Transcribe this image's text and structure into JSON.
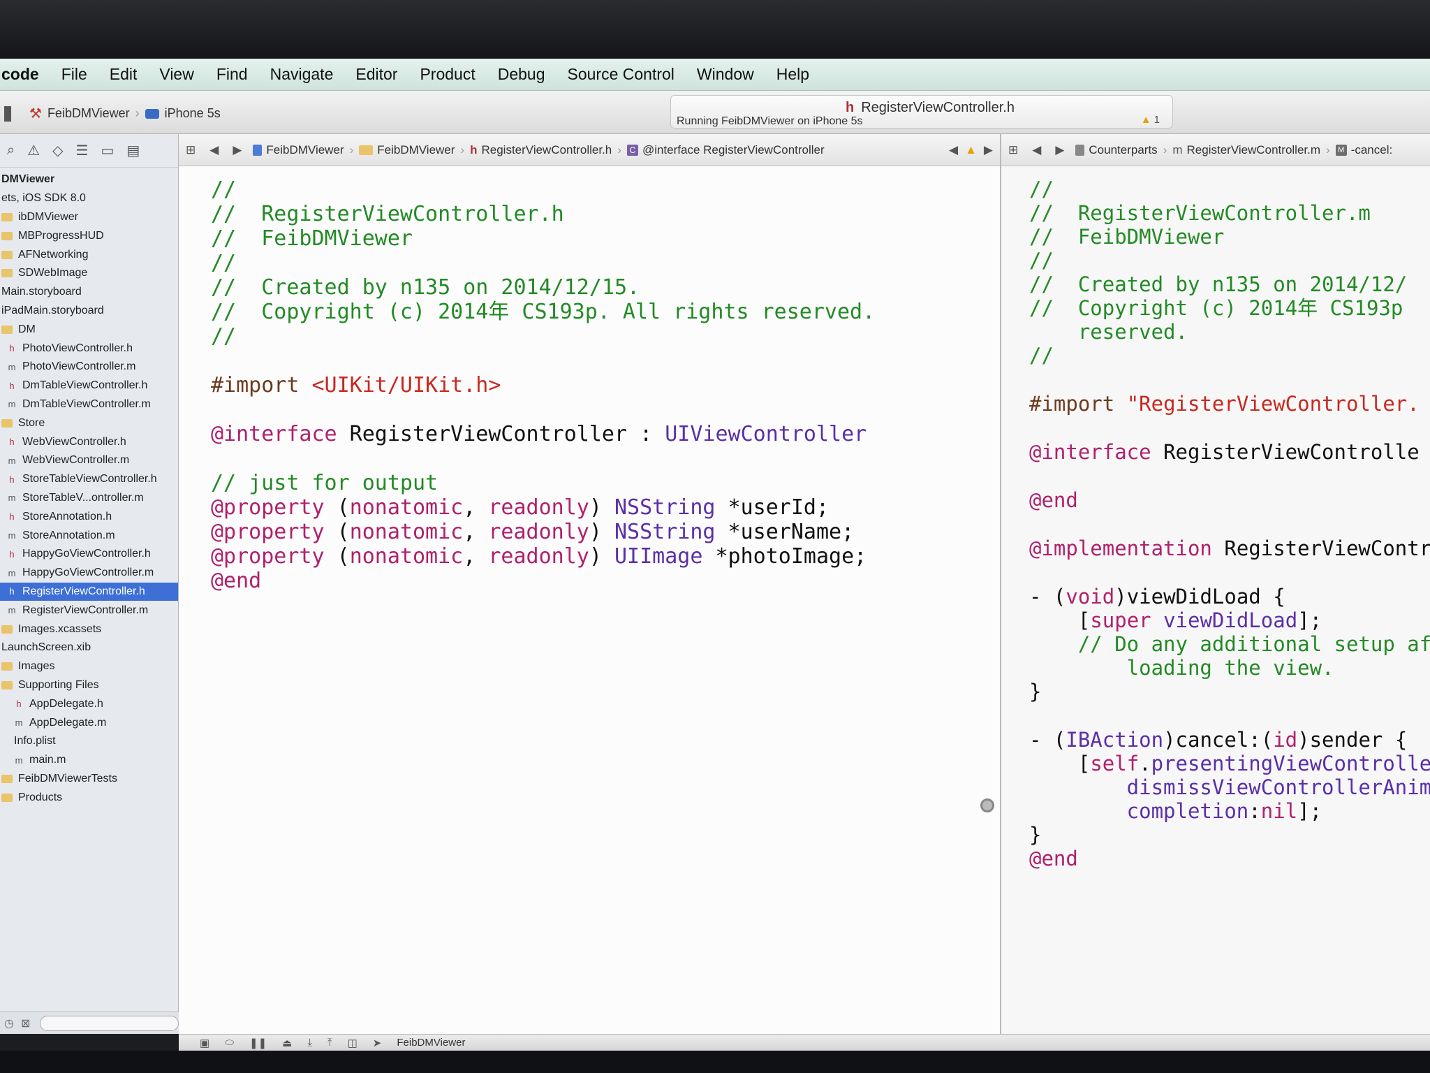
{
  "menubar": {
    "app": "code",
    "items": [
      "File",
      "Edit",
      "View",
      "Find",
      "Navigate",
      "Editor",
      "Product",
      "Debug",
      "Source Control",
      "Window",
      "Help"
    ]
  },
  "toolbar": {
    "scheme_project": "FeibDMViewer",
    "scheme_device": "iPhone 5s",
    "activity_file": "RegisterViewController.h",
    "activity_status": "Running FeibDMViewer on iPhone 5s",
    "warning_count": "1"
  },
  "navigator": {
    "items": [
      {
        "label": "DMViewer",
        "kind": "project"
      },
      {
        "label": "ets, iOS SDK 8.0",
        "kind": "sub"
      },
      {
        "label": "ibDMViewer",
        "kind": "folder"
      },
      {
        "label": "MBProgressHUD",
        "kind": "folder"
      },
      {
        "label": "AFNetworking",
        "kind": "folder"
      },
      {
        "label": "SDWebImage",
        "kind": "folder"
      },
      {
        "label": "Main.storyboard",
        "kind": "file"
      },
      {
        "label": "iPadMain.storyboard",
        "kind": "file"
      },
      {
        "label": "DM",
        "kind": "folder"
      },
      {
        "label": "PhotoViewController.h",
        "kind": "h"
      },
      {
        "label": "PhotoViewController.m",
        "kind": "m"
      },
      {
        "label": "DmTableViewController.h",
        "kind": "h"
      },
      {
        "label": "DmTableViewController.m",
        "kind": "m"
      },
      {
        "label": "Store",
        "kind": "folder"
      },
      {
        "label": "WebViewController.h",
        "kind": "h"
      },
      {
        "label": "WebViewController.m",
        "kind": "m"
      },
      {
        "label": "StoreTableViewController.h",
        "kind": "h"
      },
      {
        "label": "StoreTableV...ontroller.m",
        "kind": "m"
      },
      {
        "label": "StoreAnnotation.h",
        "kind": "h"
      },
      {
        "label": "StoreAnnotation.m",
        "kind": "m"
      },
      {
        "label": "HappyGoViewController.h",
        "kind": "h"
      },
      {
        "label": "HappyGoViewController.m",
        "kind": "m"
      },
      {
        "label": "RegisterViewController.h",
        "kind": "h",
        "selected": true
      },
      {
        "label": "RegisterViewController.m",
        "kind": "m"
      },
      {
        "label": "Images.xcassets",
        "kind": "folder"
      },
      {
        "label": "LaunchScreen.xib",
        "kind": "file"
      },
      {
        "label": "Images",
        "kind": "folder"
      },
      {
        "label": "Supporting Files",
        "kind": "folder"
      },
      {
        "label": "AppDelegate.h",
        "kind": "h"
      },
      {
        "label": "AppDelegate.m",
        "kind": "m"
      },
      {
        "label": "Info.plist",
        "kind": "file"
      },
      {
        "label": "main.m",
        "kind": "m"
      },
      {
        "label": "FeibDMViewerTests",
        "kind": "folder"
      },
      {
        "label": "Products",
        "kind": "folder"
      }
    ]
  },
  "editor_left": {
    "jumpbar": [
      "FeibDMViewer",
      "FeibDMViewer",
      "RegisterViewController.h",
      "@interface RegisterViewController"
    ],
    "lines": [
      [
        [
          "c-comment",
          "//"
        ]
      ],
      [
        [
          "c-comment",
          "//  RegisterViewController.h"
        ]
      ],
      [
        [
          "c-comment",
          "//  FeibDMViewer"
        ]
      ],
      [
        [
          "c-comment",
          "//"
        ]
      ],
      [
        [
          "c-comment",
          "//  Created by n135 on 2014/12/15."
        ]
      ],
      [
        [
          "c-comment",
          "//  Copyright (c) 2014年 CS193p. All rights reserved."
        ]
      ],
      [
        [
          "c-comment",
          "//"
        ]
      ],
      [
        [
          "c-plain",
          ""
        ]
      ],
      [
        [
          "c-dir",
          "#import "
        ],
        [
          "c-str",
          "<UIKit/UIKit.h>"
        ]
      ],
      [
        [
          "c-plain",
          ""
        ]
      ],
      [
        [
          "c-kw",
          "@interface"
        ],
        [
          "c-plain",
          " RegisterViewController : "
        ],
        [
          "c-type",
          "UIViewController"
        ]
      ],
      [
        [
          "c-plain",
          ""
        ]
      ],
      [
        [
          "c-comment",
          "// just for output"
        ]
      ],
      [
        [
          "c-kw",
          "@property"
        ],
        [
          "c-plain",
          " ("
        ],
        [
          "c-kw",
          "nonatomic"
        ],
        [
          "c-plain",
          ", "
        ],
        [
          "c-kw",
          "readonly"
        ],
        [
          "c-plain",
          ") "
        ],
        [
          "c-type",
          "NSString"
        ],
        [
          "c-plain",
          " *userId;"
        ]
      ],
      [
        [
          "c-kw",
          "@property"
        ],
        [
          "c-plain",
          " ("
        ],
        [
          "c-kw",
          "nonatomic"
        ],
        [
          "c-plain",
          ", "
        ],
        [
          "c-kw",
          "readonly"
        ],
        [
          "c-plain",
          ") "
        ],
        [
          "c-type",
          "NSString"
        ],
        [
          "c-plain",
          " *userName;"
        ]
      ],
      [
        [
          "c-kw",
          "@property"
        ],
        [
          "c-plain",
          " ("
        ],
        [
          "c-kw",
          "nonatomic"
        ],
        [
          "c-plain",
          ", "
        ],
        [
          "c-kw",
          "readonly"
        ],
        [
          "c-plain",
          ") "
        ],
        [
          "c-type",
          "UIImage"
        ],
        [
          "c-plain",
          " *photoImage;"
        ]
      ],
      [
        [
          "c-kw",
          "@end"
        ]
      ]
    ]
  },
  "editor_right": {
    "jumpbar": [
      "Counterparts",
      "RegisterViewController.m",
      "-cancel:"
    ],
    "lines": [
      [
        [
          "c-comment",
          "//"
        ]
      ],
      [
        [
          "c-comment",
          "//  RegisterViewController.m"
        ]
      ],
      [
        [
          "c-comment",
          "//  FeibDMViewer"
        ]
      ],
      [
        [
          "c-comment",
          "//"
        ]
      ],
      [
        [
          "c-comment",
          "//  Created by n135 on 2014/12/"
        ]
      ],
      [
        [
          "c-comment",
          "//  Copyright (c) 2014年 CS193p"
        ]
      ],
      [
        [
          "c-comment",
          "    reserved."
        ]
      ],
      [
        [
          "c-comment",
          "//"
        ]
      ],
      [
        [
          "c-plain",
          ""
        ]
      ],
      [
        [
          "c-dir",
          "#import "
        ],
        [
          "c-str",
          "\"RegisterViewController."
        ]
      ],
      [
        [
          "c-plain",
          ""
        ]
      ],
      [
        [
          "c-kw",
          "@interface"
        ],
        [
          "c-plain",
          " RegisterViewControlle"
        ]
      ],
      [
        [
          "c-plain",
          ""
        ]
      ],
      [
        [
          "c-kw",
          "@end"
        ]
      ],
      [
        [
          "c-plain",
          ""
        ]
      ],
      [
        [
          "c-kw",
          "@implementation"
        ],
        [
          "c-plain",
          " RegisterViewContr"
        ]
      ],
      [
        [
          "c-plain",
          ""
        ]
      ],
      [
        [
          "c-plain",
          "- ("
        ],
        [
          "c-kw",
          "void"
        ],
        [
          "c-plain",
          ")viewDidLoad {"
        ]
      ],
      [
        [
          "c-plain",
          "    ["
        ],
        [
          "c-kw",
          "super"
        ],
        [
          "c-plain",
          " "
        ],
        [
          "c-type",
          "viewDidLoad"
        ],
        [
          "c-plain",
          "];"
        ]
      ],
      [
        [
          "c-comment",
          "    // Do any additional setup af"
        ]
      ],
      [
        [
          "c-comment",
          "        loading the view."
        ]
      ],
      [
        [
          "c-plain",
          "}"
        ]
      ],
      [
        [
          "c-plain",
          ""
        ]
      ],
      [
        [
          "c-plain",
          "- ("
        ],
        [
          "c-type",
          "IBAction"
        ],
        [
          "c-plain",
          ")cancel:("
        ],
        [
          "c-kw",
          "id"
        ],
        [
          "c-plain",
          ")sender {"
        ]
      ],
      [
        [
          "c-plain",
          "    ["
        ],
        [
          "c-kw",
          "self"
        ],
        [
          "c-plain",
          "."
        ],
        [
          "c-type",
          "presentingViewController"
        ]
      ],
      [
        [
          "c-type",
          "        dismissViewControllerAnimat"
        ]
      ],
      [
        [
          "c-type",
          "        completion"
        ],
        [
          "c-plain",
          ":"
        ],
        [
          "c-kw",
          "nil"
        ],
        [
          "c-plain",
          "];"
        ]
      ],
      [
        [
          "c-plain",
          "}"
        ]
      ],
      [
        [
          "c-kw",
          "@end"
        ]
      ]
    ]
  },
  "debugbar": {
    "target": "FeibDMViewer"
  }
}
